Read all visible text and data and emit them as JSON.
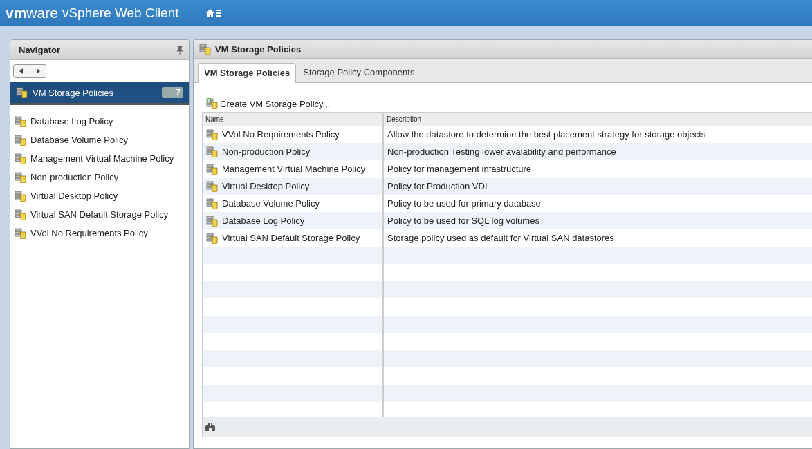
{
  "header": {
    "logo": "**vm**ware",
    "product": "vSphere Web Client"
  },
  "navigator": {
    "title": "Navigator",
    "selected_item": {
      "label": "VM Storage Policies",
      "count": "7"
    },
    "items": [
      "Database Log Policy",
      "Database Volume Policy",
      "Management Virtual Machine Policy",
      "Non-production Policy",
      "Virtual Desktop Policy",
      "Virtual SAN Default Storage Policy",
      "VVol No Requirements Policy"
    ]
  },
  "main": {
    "title": "VM Storage Policies",
    "tabs": [
      {
        "label": "VM Storage Policies",
        "selected": true
      },
      {
        "label": "Storage Policy Components",
        "selected": false
      }
    ],
    "create_action": "Create VM Storage Policy...",
    "table": {
      "columns": [
        "Name",
        "Description"
      ],
      "rows": [
        {
          "name": "VVol No Requirements Policy",
          "description": "Allow the datastore to determine the best placement strategy for storage objects"
        },
        {
          "name": "Non-production Policy",
          "description": "Non-production Testing lower avalability and performance"
        },
        {
          "name": "Management Virtual Machine Policy",
          "description": "Policy for management infastructure"
        },
        {
          "name": "Virtual Desktop Policy",
          "description": "Policy for Production VDI"
        },
        {
          "name": "Database Volume Policy",
          "description": "Policy to be used for primary database"
        },
        {
          "name": "Database Log Policy",
          "description": "Policy to be used for SQL log volumes"
        },
        {
          "name": "Virtual SAN Default Storage Policy",
          "description": "Storage policy used as default for Virtual SAN datastores"
        }
      ]
    }
  }
}
